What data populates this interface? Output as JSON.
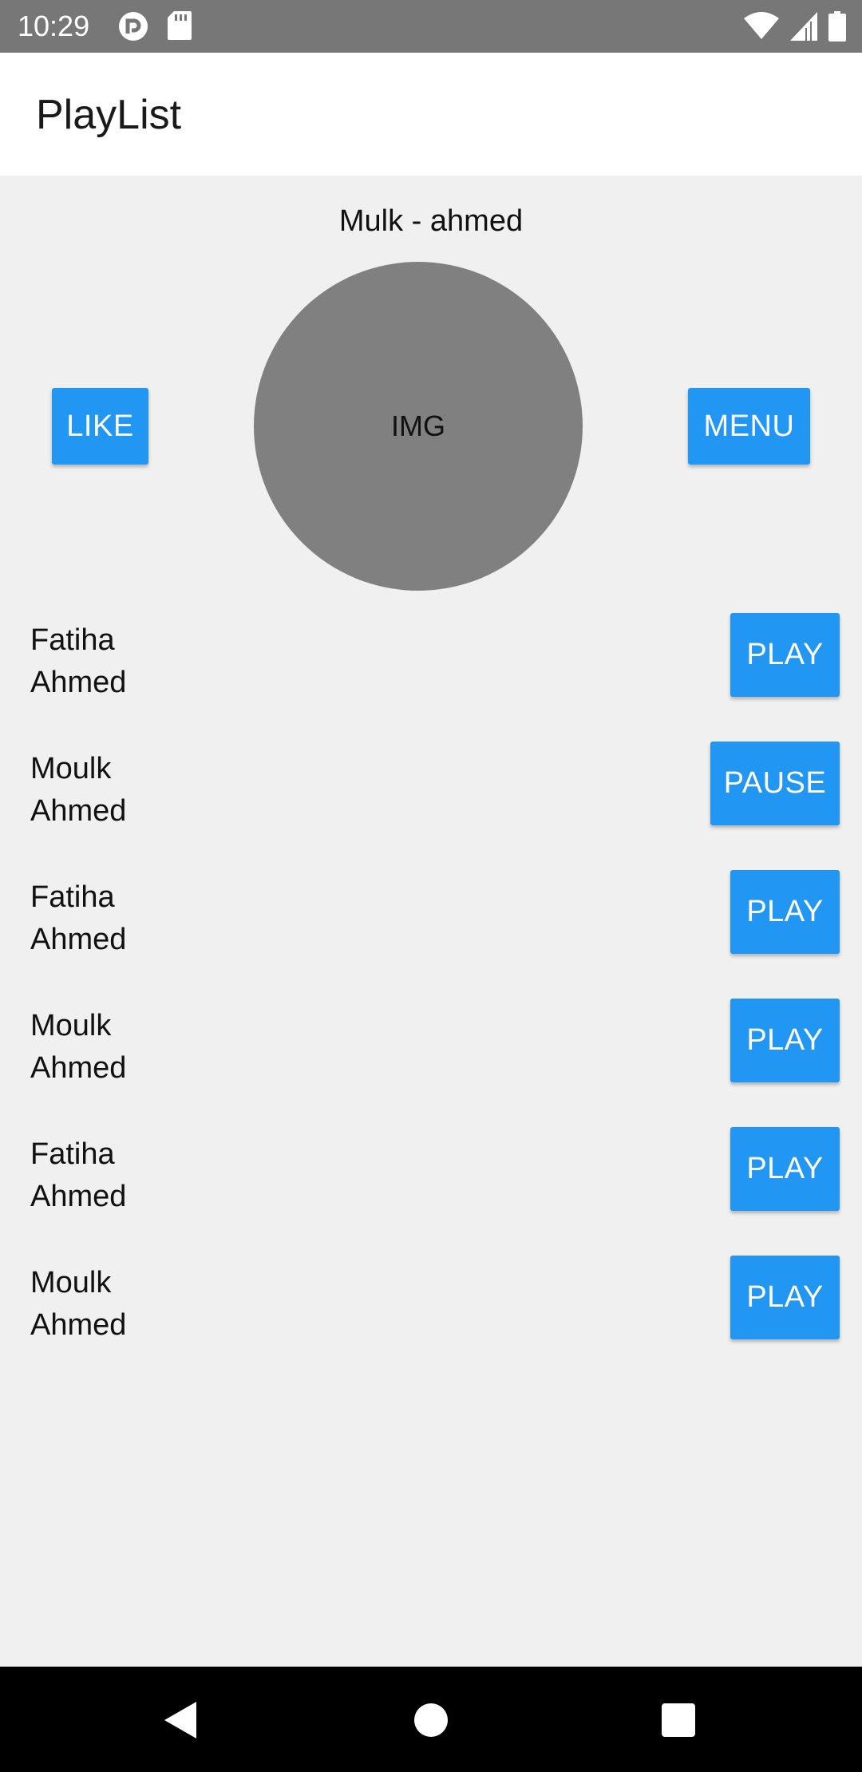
{
  "status_bar": {
    "time": "10:29",
    "left_icons": [
      "nfc-icon",
      "sd-card-icon"
    ],
    "right_icons": [
      "wifi-icon",
      "signal-icon",
      "battery-icon"
    ]
  },
  "app_bar": {
    "title": "PlayList"
  },
  "now_playing": {
    "title": "Mulk - ahmed",
    "image_label": "IMG",
    "like_label": "LIKE",
    "menu_label": "MENU"
  },
  "playlist": [
    {
      "title": "Fatiha",
      "artist": "Ahmed",
      "button": "PLAY"
    },
    {
      "title": "Moulk",
      "artist": "Ahmed",
      "button": "PAUSE"
    },
    {
      "title": "Fatiha",
      "artist": "Ahmed",
      "button": "PLAY"
    },
    {
      "title": "Moulk",
      "artist": "Ahmed",
      "button": "PLAY"
    },
    {
      "title": "Fatiha",
      "artist": "Ahmed",
      "button": "PLAY"
    },
    {
      "title": "Moulk",
      "artist": "Ahmed",
      "button": "PLAY"
    }
  ],
  "nav_bar": {
    "icons": [
      "back-icon",
      "home-icon",
      "recents-icon"
    ]
  },
  "colors": {
    "accent": "#2196f3",
    "status_bar": "#777777",
    "background": "#f0f0f0",
    "cover": "#808080"
  }
}
